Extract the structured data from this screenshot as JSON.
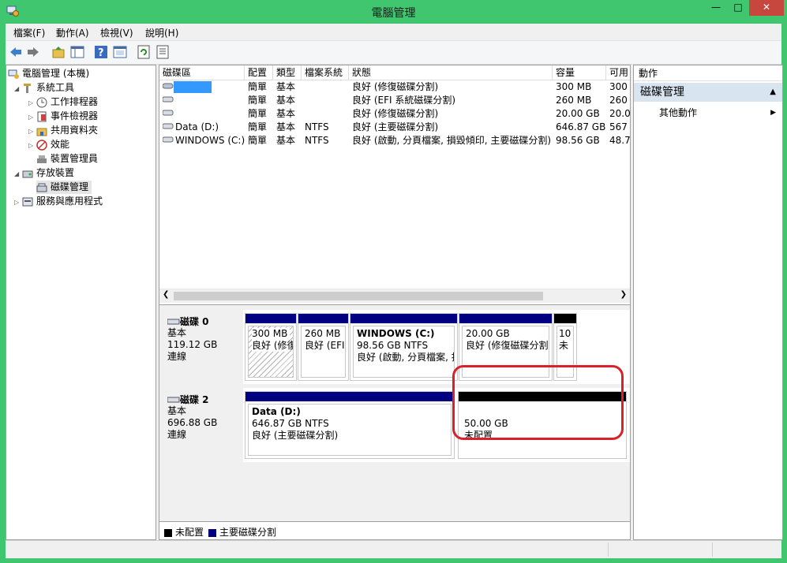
{
  "window": {
    "title": "電腦管理"
  },
  "menu": [
    "檔案(F)",
    "動作(A)",
    "檢視(V)",
    "說明(H)"
  ],
  "toolbar_icons": [
    "back-icon",
    "forward-icon",
    "up-folder-icon",
    "show-hide-tree-icon",
    "help-icon",
    "properties-icon",
    "refresh-icon",
    "export-icon"
  ],
  "tree": {
    "root": "電腦管理 (本機)",
    "system_tools": "系統工具",
    "task_scheduler": "工作排程器",
    "event_viewer": "事件檢視器",
    "shared_folders": "共用資料夾",
    "performance": "效能",
    "device_manager": "裝置管理員",
    "storage": "存放裝置",
    "disk_management": "磁碟管理",
    "services_apps": "服務與應用程式"
  },
  "list": {
    "headers": [
      "磁碟區",
      "配置",
      "類型",
      "檔案系統",
      "狀態",
      "容量",
      "可用"
    ],
    "rows": [
      {
        "volume": "",
        "layout": "簡單",
        "type": "基本",
        "fs": "",
        "status": "良好 (修復磁碟分割)",
        "capacity": "300 MB",
        "free": "300"
      },
      {
        "volume": "",
        "layout": "簡單",
        "type": "基本",
        "fs": "",
        "status": "良好 (EFI 系統磁碟分割)",
        "capacity": "260 MB",
        "free": "260"
      },
      {
        "volume": "",
        "layout": "簡單",
        "type": "基本",
        "fs": "",
        "status": "良好 (修復磁碟分割)",
        "capacity": "20.00 GB",
        "free": "20.0"
      },
      {
        "volume": "Data (D:)",
        "layout": "簡單",
        "type": "基本",
        "fs": "NTFS",
        "status": "良好 (主要磁碟分割)",
        "capacity": "646.87 GB",
        "free": "567"
      },
      {
        "volume": "WINDOWS (C:)",
        "layout": "簡單",
        "type": "基本",
        "fs": "NTFS",
        "status": "良好 (啟動, 分頁檔案, 損毀傾印, 主要磁碟分割)",
        "capacity": "98.56 GB",
        "free": "48.7"
      }
    ]
  },
  "disk0": {
    "name": "磁碟 0",
    "type": "基本",
    "size": "119.12 GB",
    "state": "連線",
    "parts": [
      {
        "name": "",
        "size": "300 MB",
        "status": "良好 (修復"
      },
      {
        "name": "",
        "size": "260 MB",
        "status": "良好 (EFI"
      },
      {
        "name": "WINDOWS  (C:)",
        "size": "98.56 GB NTFS",
        "status": "良好 (啟動, 分頁檔案, 損"
      },
      {
        "name": "",
        "size": "20.00 GB",
        "status": "良好 (修復磁碟分割"
      },
      {
        "name": "",
        "size": "10",
        "status": "未"
      }
    ]
  },
  "disk2": {
    "name": "磁碟 2",
    "type": "基本",
    "size": "696.88 GB",
    "state": "連線",
    "parts": [
      {
        "name": "Data  (D:)",
        "size": "646.87 GB NTFS",
        "status": "良好 (主要磁碟分割)"
      },
      {
        "name": "",
        "size": "50.00 GB",
        "status": "未配置"
      }
    ]
  },
  "legend": {
    "unallocated": "未配置",
    "primary": "主要磁碟分割"
  },
  "colors": {
    "primary": "#000080",
    "unallocated": "#000000",
    "highlight": "#d8212a",
    "frame": "#3fc66f"
  },
  "actions": {
    "header": "動作",
    "section": "磁碟管理",
    "more": "其他動作"
  }
}
